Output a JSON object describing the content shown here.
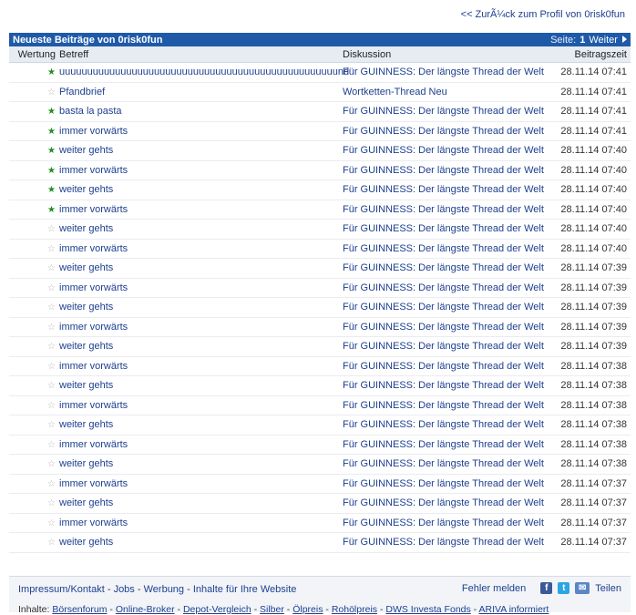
{
  "back_link": "<< ZurÃ¼ck zum Profil von 0risk0fun",
  "panel": {
    "title": "Neueste Beiträge von 0risk0fun",
    "pager_label": "Seite:",
    "page_current": "1",
    "next_label": "Weiter"
  },
  "columns": {
    "rating": "Wertung",
    "subject": "Betreff",
    "discussion": "Diskussion",
    "time": "Beitragszeit"
  },
  "rows": [
    {
      "rated": true,
      "subject": "uuuuuuuuuuuuuuuuuuuuuuuuuuuuuuuuuuuuuuuuuuuuuuuuuund",
      "discussion": "Für GUINNESS: Der längste Thread der Welt",
      "time": "28.11.14 07:41"
    },
    {
      "rated": false,
      "subject": "Pfandbrief",
      "discussion": "Wortketten-Thread Neu",
      "time": "28.11.14 07:41"
    },
    {
      "rated": true,
      "subject": "basta la pasta",
      "discussion": "Für GUINNESS: Der längste Thread der Welt",
      "time": "28.11.14 07:41"
    },
    {
      "rated": true,
      "subject": "immer vorwärts",
      "discussion": "Für GUINNESS: Der längste Thread der Welt",
      "time": "28.11.14 07:41"
    },
    {
      "rated": true,
      "subject": "weiter gehts",
      "discussion": "Für GUINNESS: Der längste Thread der Welt",
      "time": "28.11.14 07:40"
    },
    {
      "rated": true,
      "subject": "immer vorwärts",
      "discussion": "Für GUINNESS: Der längste Thread der Welt",
      "time": "28.11.14 07:40"
    },
    {
      "rated": true,
      "subject": "weiter gehts",
      "discussion": "Für GUINNESS: Der längste Thread der Welt",
      "time": "28.11.14 07:40"
    },
    {
      "rated": true,
      "subject": "immer vorwärts",
      "discussion": "Für GUINNESS: Der längste Thread der Welt",
      "time": "28.11.14 07:40"
    },
    {
      "rated": false,
      "subject": "weiter gehts",
      "discussion": "Für GUINNESS: Der längste Thread der Welt",
      "time": "28.11.14 07:40"
    },
    {
      "rated": false,
      "subject": "immer vorwärts",
      "discussion": "Für GUINNESS: Der längste Thread der Welt",
      "time": "28.11.14 07:40"
    },
    {
      "rated": false,
      "subject": "weiter gehts",
      "discussion": "Für GUINNESS: Der längste Thread der Welt",
      "time": "28.11.14 07:39"
    },
    {
      "rated": false,
      "subject": "immer vorwärts",
      "discussion": "Für GUINNESS: Der längste Thread der Welt",
      "time": "28.11.14 07:39"
    },
    {
      "rated": false,
      "subject": "weiter gehts",
      "discussion": "Für GUINNESS: Der längste Thread der Welt",
      "time": "28.11.14 07:39"
    },
    {
      "rated": false,
      "subject": "immer vorwärts",
      "discussion": "Für GUINNESS: Der längste Thread der Welt",
      "time": "28.11.14 07:39"
    },
    {
      "rated": false,
      "subject": "weiter gehts",
      "discussion": "Für GUINNESS: Der längste Thread der Welt",
      "time": "28.11.14 07:39"
    },
    {
      "rated": false,
      "subject": "immer vorwärts",
      "discussion": "Für GUINNESS: Der längste Thread der Welt",
      "time": "28.11.14 07:38"
    },
    {
      "rated": false,
      "subject": "weiter gehts",
      "discussion": "Für GUINNESS: Der längste Thread der Welt",
      "time": "28.11.14 07:38"
    },
    {
      "rated": false,
      "subject": "immer vorwärts",
      "discussion": "Für GUINNESS: Der längste Thread der Welt",
      "time": "28.11.14 07:38"
    },
    {
      "rated": false,
      "subject": "weiter gehts",
      "discussion": "Für GUINNESS: Der längste Thread der Welt",
      "time": "28.11.14 07:38"
    },
    {
      "rated": false,
      "subject": "immer vorwärts",
      "discussion": "Für GUINNESS: Der längste Thread der Welt",
      "time": "28.11.14 07:38"
    },
    {
      "rated": false,
      "subject": "weiter gehts",
      "discussion": "Für GUINNESS: Der längste Thread der Welt",
      "time": "28.11.14 07:38"
    },
    {
      "rated": false,
      "subject": "immer vorwärts",
      "discussion": "Für GUINNESS: Der längste Thread der Welt",
      "time": "28.11.14 07:37"
    },
    {
      "rated": false,
      "subject": "weiter gehts",
      "discussion": "Für GUINNESS: Der längste Thread der Welt",
      "time": "28.11.14 07:37"
    },
    {
      "rated": false,
      "subject": "immer vorwärts",
      "discussion": "Für GUINNESS: Der längste Thread der Welt",
      "time": "28.11.14 07:37"
    },
    {
      "rated": false,
      "subject": "weiter gehts",
      "discussion": "Für GUINNESS: Der längste Thread der Welt",
      "time": "28.11.14 07:37"
    }
  ],
  "footer": {
    "links": [
      "Impressum/Kontakt",
      "Jobs",
      "Werbung",
      "Inhalte für Ihre Website"
    ],
    "report": "Fehler melden",
    "share": "Teilen",
    "inhalte_label": "Inhalte:",
    "inhalte_links": [
      "Börsenforum",
      "Online-Broker",
      "Depot-Vergleich",
      "Silber",
      "Ölpreis",
      "Rohölpreis",
      "DWS Investa Fonds",
      "ARIVA informiert"
    ]
  },
  "icons": {
    "star_rated": "star-filled-icon",
    "star_unrated": "star-outline-icon",
    "next": "triangle-right-icon",
    "facebook": "facebook-icon",
    "twitter": "twitter-icon",
    "mail": "mail-icon"
  },
  "colors": {
    "header_bar": "#1f5aa8",
    "link": "#1c3f8f",
    "star_on": "#1f8f1f",
    "star_off": "#b7b7b7"
  }
}
